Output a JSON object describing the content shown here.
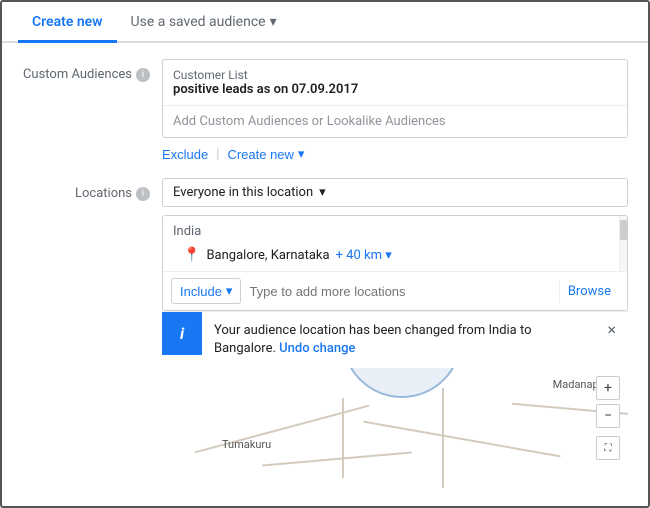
{
  "tabs": {
    "create_new": "Create new",
    "use_saved": "Use a saved audience",
    "active": "create_new"
  },
  "form": {
    "custom_audiences_label": "Custom Audiences",
    "audience_tag_label": "Customer List",
    "audience_tag_value": "positive leads as on 07.09.2017",
    "audience_add_placeholder": "Add Custom Audiences or Lookalike Audiences",
    "exclude_label": "Exclude",
    "create_new_label": "Create new",
    "locations_label": "Locations",
    "location_dropdown": "Everyone in this location",
    "country_label": "India",
    "city_label": "Bangalore, Karnataka",
    "city_km": "+ 40 km",
    "include_label": "Include",
    "location_type_placeholder": "Type to add more locations",
    "browse_label": "Browse",
    "notification_text": "Your audience location has been changed from India to Bangalore.",
    "notification_undo": "Undo change",
    "map_label_1": "Tumakuru",
    "map_label_2": "Madanapalle,"
  },
  "icons": {
    "info": "i",
    "chevron_down": "▾",
    "pin": "📍",
    "close": "×",
    "info_blue": "i",
    "plus": "+",
    "minus": "−",
    "fullscreen": "⛶",
    "checkmark": "✓"
  }
}
